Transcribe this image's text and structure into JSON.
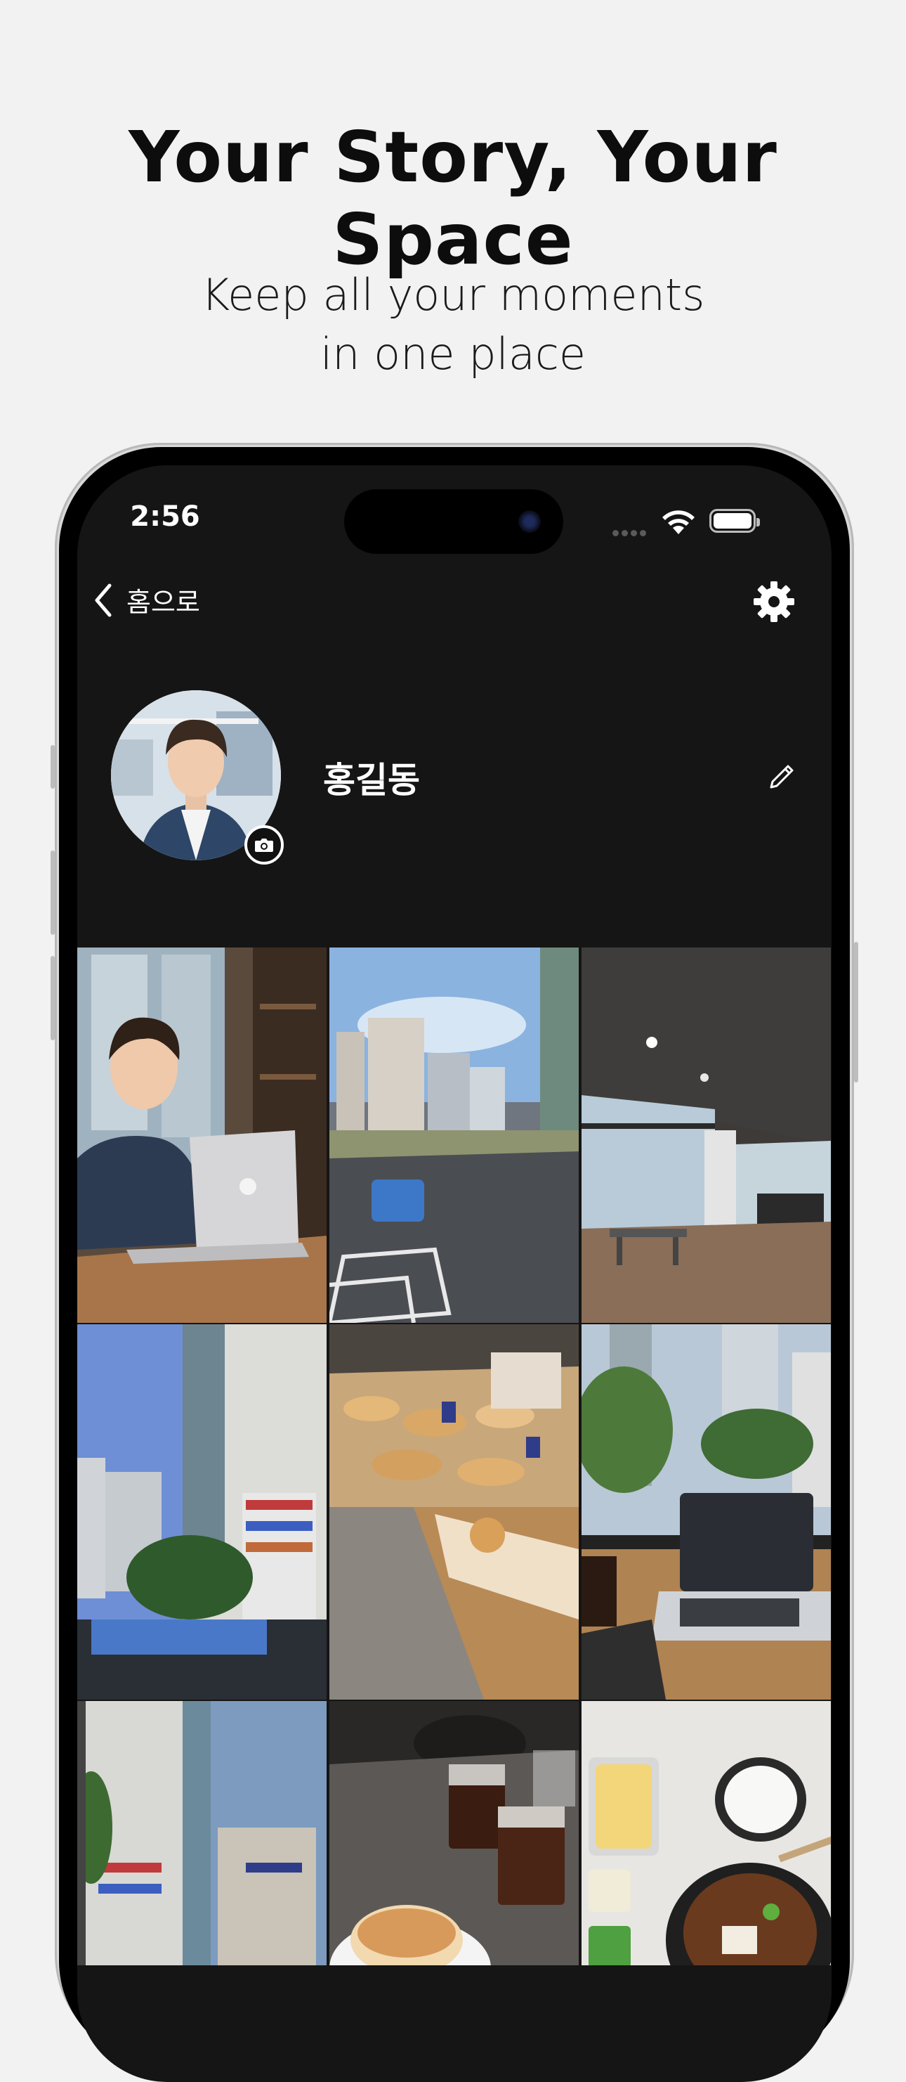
{
  "marketing": {
    "headline": "Your Story, Your Space",
    "subtitle_line1": "Keep all your moments",
    "subtitle_line2": "in one place"
  },
  "status_bar": {
    "time": "2:56"
  },
  "nav": {
    "back_label": "홈으로",
    "back_icon": "chevron-left-icon",
    "settings_icon": "gear-icon"
  },
  "profile": {
    "name": "홍길동",
    "avatar_icon": "avatar",
    "camera_icon": "camera-icon",
    "edit_icon": "pencil-icon"
  },
  "photos": [
    {
      "subject": "man-with-laptop-cafe"
    },
    {
      "subject": "street-with-bus"
    },
    {
      "subject": "gym-interior"
    },
    {
      "subject": "building-blue-sky"
    },
    {
      "subject": "bakery-display"
    },
    {
      "subject": "laptop-coffee-window"
    },
    {
      "subject": "glass-building"
    },
    {
      "subject": "iced-coffee-bread"
    },
    {
      "subject": "korean-meal-tray"
    }
  ],
  "colors": {
    "page_bg": "#f2f2f2",
    "screen_bg": "#151515",
    "text_dark": "#0d0d0d",
    "text_light": "#ffffff"
  }
}
